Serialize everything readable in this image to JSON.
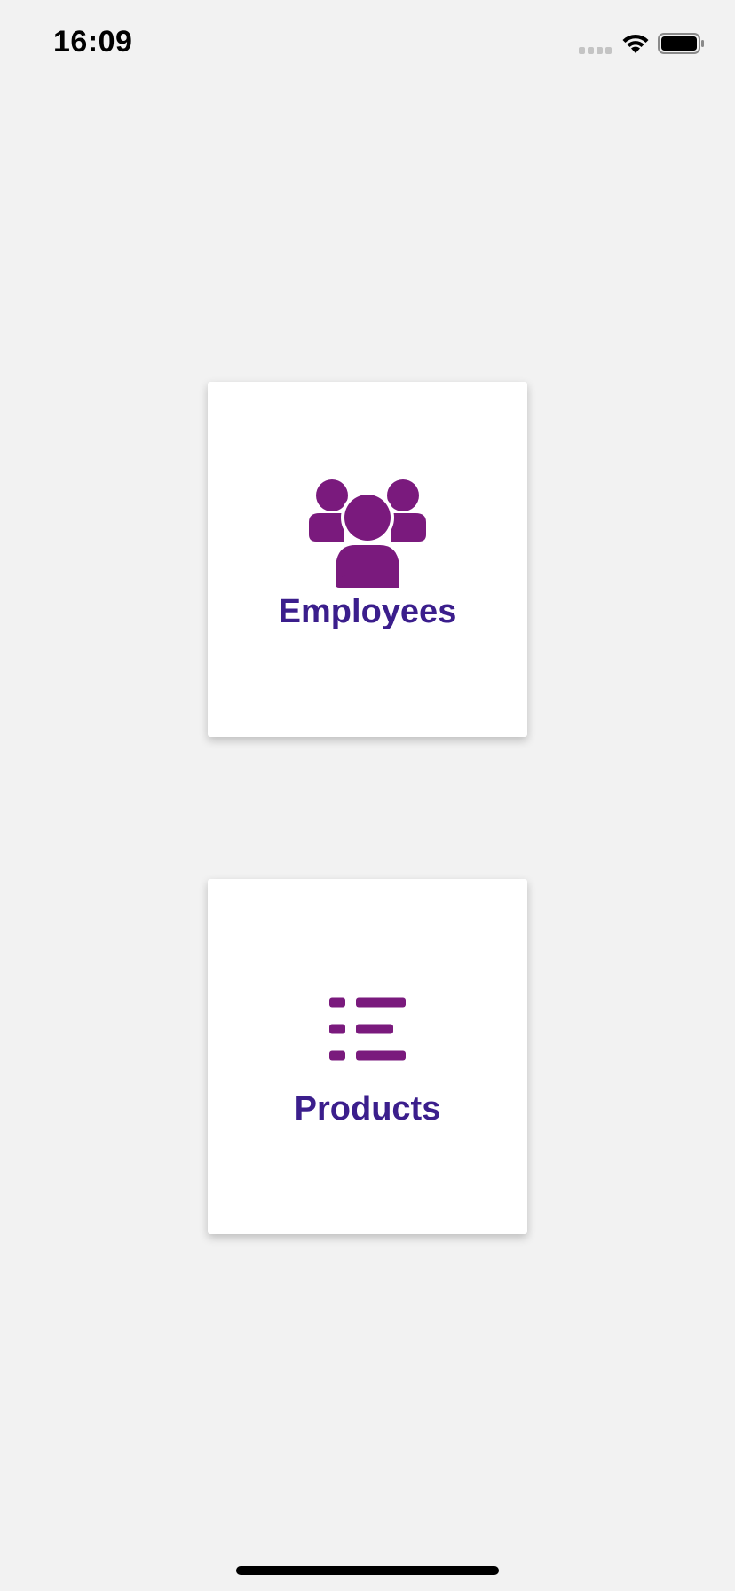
{
  "status_bar": {
    "time": "16:09",
    "icons": [
      "cellular-signal-icon",
      "wifi-icon",
      "battery-icon"
    ]
  },
  "menu": {
    "tiles": [
      {
        "label": "Employees",
        "icon": "users-group-icon"
      },
      {
        "label": "Products",
        "icon": "list-icon"
      }
    ]
  },
  "colors": {
    "background": "#f2f2f2",
    "tile_background": "#ffffff",
    "icon_color": "#7a1a7d",
    "label_color": "#3b1e8c"
  }
}
